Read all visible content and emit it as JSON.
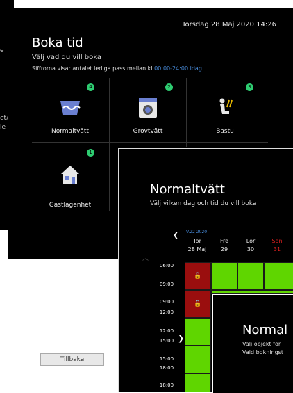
{
  "background_screen": {
    "fragments": [
      "e",
      "et/",
      "le"
    ]
  },
  "booking_screen": {
    "datetime": "Torsdag 28 Maj 2020   14:26",
    "title": "Boka tid",
    "subtitle": "Välj vad du vill boka",
    "info_prefix": "Siffrorna visar antalet lediga pass mellan kl ",
    "info_highlight": "00:00-24:00 idag",
    "tiles": [
      {
        "label": "Normaltvätt",
        "count": "4",
        "icon": "washing-icon"
      },
      {
        "label": "Grovtvätt",
        "count": "2",
        "icon": "washing-machine-icon"
      },
      {
        "label": "Bastu",
        "count": "3",
        "icon": "sauna-icon"
      },
      {
        "label": "Gästlägenhet",
        "count": "1",
        "icon": "house-icon"
      }
    ],
    "back_button": "Tillbaka"
  },
  "calendar_screen": {
    "title": "Normaltvätt",
    "subtitle": "Välj vilken dag och tid du vill boka",
    "week": "V.22 2020",
    "days": [
      {
        "name": "Tor",
        "date": "28 Maj",
        "weekend": false
      },
      {
        "name": "Fre",
        "date": "29",
        "weekend": false
      },
      {
        "name": "Lör",
        "date": "30",
        "weekend": false
      },
      {
        "name": "Sön",
        "date": "31",
        "weekend": true
      }
    ],
    "times": [
      "06:00",
      "09:00",
      "09:00",
      "12:00",
      "12:00",
      "15:00",
      "15:00",
      "18:00",
      "18:00"
    ],
    "slots_first_column": [
      "booked",
      "booked",
      "free",
      "free",
      "free"
    ],
    "colors": {
      "free": "#5fd600",
      "booked": "#9a0e0e",
      "accent": "#4a90e2",
      "sunday": "#e02020",
      "badge": "#2ecc71"
    }
  },
  "object_screen": {
    "title": "Normal",
    "subtitle": "Välj objekt för",
    "subtitle2": "Vald bokningst"
  }
}
